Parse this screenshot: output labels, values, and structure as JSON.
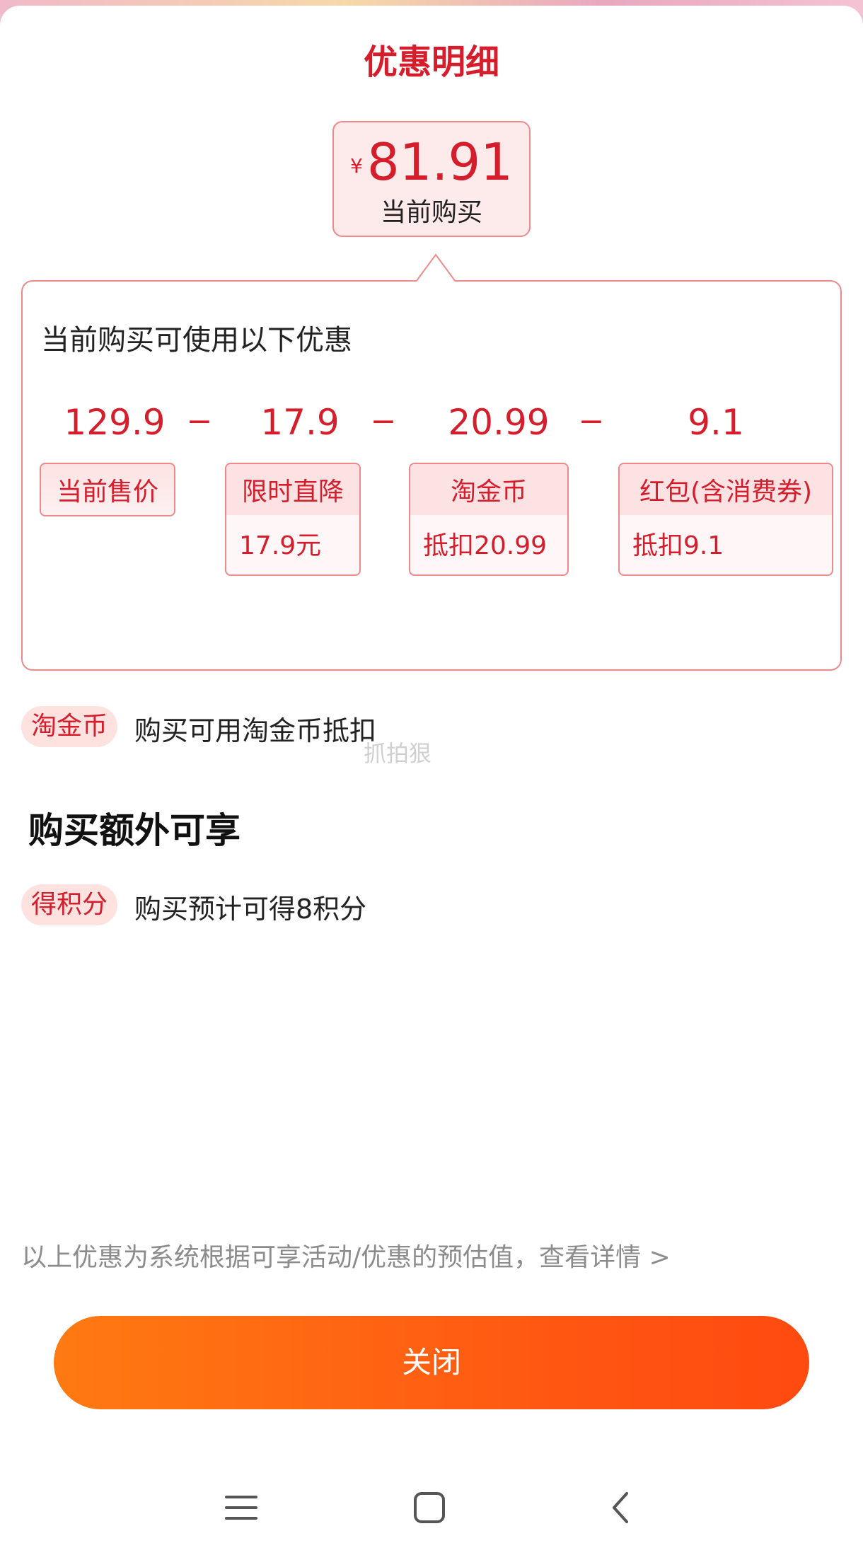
{
  "header": {
    "title": "优惠明细"
  },
  "price": {
    "currency": "¥",
    "amount": "81.91",
    "caption": "当前购买"
  },
  "detail": {
    "heading": "当前购买可使用以下优惠",
    "items": [
      {
        "amount": "129.9",
        "label": "当前售价",
        "sub": ""
      },
      {
        "amount": "17.9",
        "label": "限时直降",
        "sub": "17.9元"
      },
      {
        "amount": "20.99",
        "label": "淘金币",
        "sub": "抵扣20.99"
      },
      {
        "amount": "9.1",
        "label": "红包(含消费券)",
        "sub": "抵扣9.1"
      }
    ],
    "operator": "−"
  },
  "benefits": [
    {
      "tag": "淘金币",
      "text": "购买可用淘金币抵扣"
    }
  ],
  "extra": {
    "heading": "购买额外可享",
    "items": [
      {
        "tag": "得积分",
        "text": "购买预计可得8积分"
      }
    ]
  },
  "watermark": "抓拍狠",
  "footnote": "以上优惠为系统根据可享活动/优惠的预估值，查看详情 >",
  "close_label": "关闭",
  "nav": {
    "icons": [
      "menu-icon",
      "home-square-icon",
      "back-chevron-icon"
    ]
  },
  "colors": {
    "accent": "#d61d2c",
    "button": "#ff5512",
    "tag_bg": "#fde2e0"
  }
}
